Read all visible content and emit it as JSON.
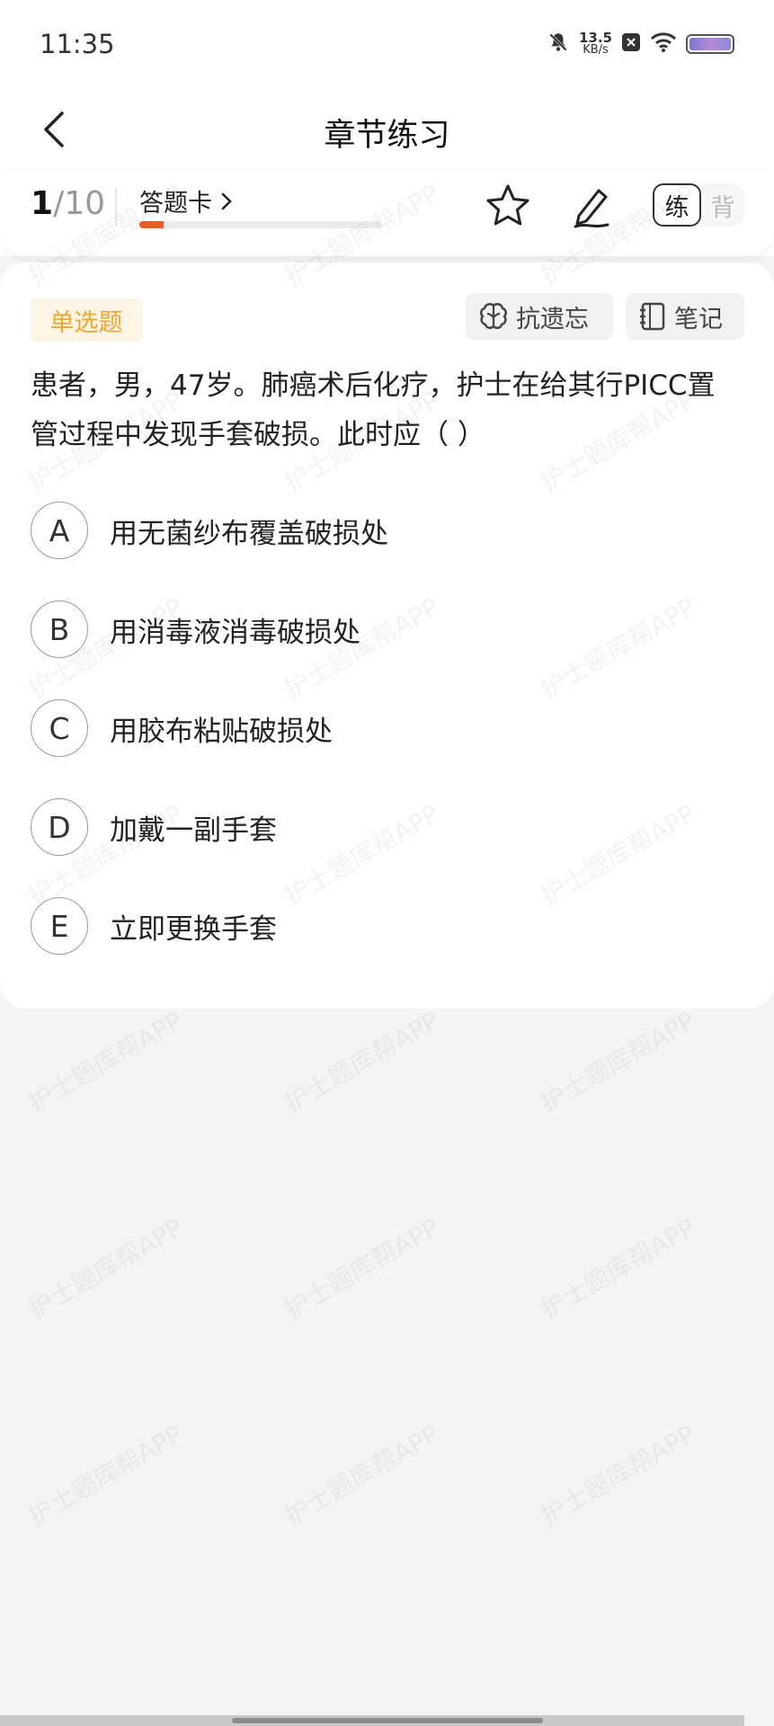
{
  "status_bar": {
    "time": "11:35",
    "net_speed_value": "13.5",
    "net_speed_unit": "KB/s",
    "icons": [
      "mute-bell-icon",
      "x-notification-icon",
      "wifi-icon",
      "battery-icon"
    ]
  },
  "nav": {
    "title": "章节练习",
    "back_icon": "chevron-left-icon"
  },
  "toolbar": {
    "current": "1",
    "total": "/10",
    "answer_card_label": "答题卡",
    "answer_card_progress_fraction": 0.1,
    "mode_practice": "练",
    "mode_recite": "背",
    "progress_color": "#f05a28"
  },
  "question": {
    "type_label": "单选题",
    "anti_forget_label": "抗遗忘",
    "notes_label": "笔记",
    "text": "患者，男，47岁。肺癌术后化疗，护士在给其行PICC置管过程中发现手套破损。此时应（ ）",
    "options": [
      {
        "letter": "A",
        "text": "用无菌纱布覆盖破损处"
      },
      {
        "letter": "B",
        "text": "用消毒液消毒破损处"
      },
      {
        "letter": "C",
        "text": "用胶布粘贴破损处"
      },
      {
        "letter": "D",
        "text": "加戴一副手套"
      },
      {
        "letter": "E",
        "text": "立即更换手套"
      }
    ]
  },
  "watermark": "护士题库帮APP",
  "colors": {
    "accent": "#f05a28",
    "badge_text": "#f1a72e",
    "badge_bg": "#fdf4e6"
  }
}
